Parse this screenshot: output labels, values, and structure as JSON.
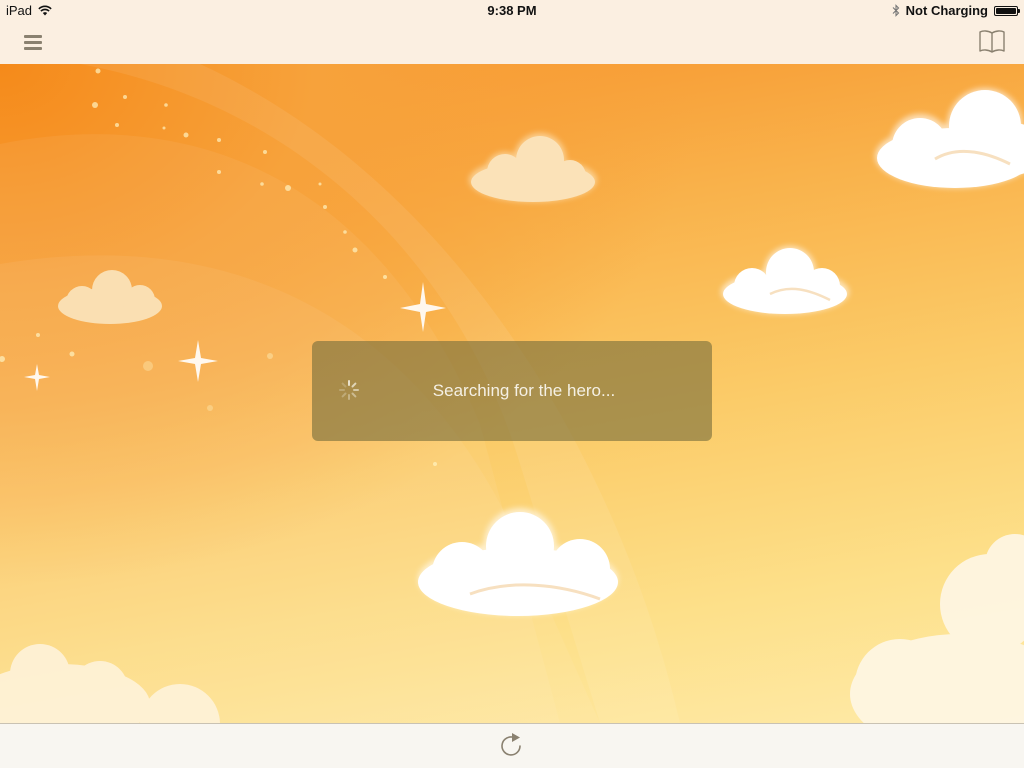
{
  "status_bar": {
    "device": "iPad",
    "time": "9:38 PM",
    "battery_status": "Not Charging",
    "icons": [
      "wifi-icon",
      "bluetooth-icon",
      "battery-icon"
    ]
  },
  "nav_bar": {
    "left_icon": "menu-icon",
    "right_icon": "book-icon"
  },
  "loading": {
    "message": "Searching for the hero...",
    "icon": "spinner-icon"
  },
  "toolbar": {
    "center_icon": "replay-icon"
  },
  "colors": {
    "sky_top": "#f58a1a",
    "sky_bottom": "#feeaa8",
    "bar_background": "#fbefe1",
    "toolbar_background": "#f8f6f1",
    "icon_tint": "#8a8170",
    "hud_background": "#786e3c"
  }
}
